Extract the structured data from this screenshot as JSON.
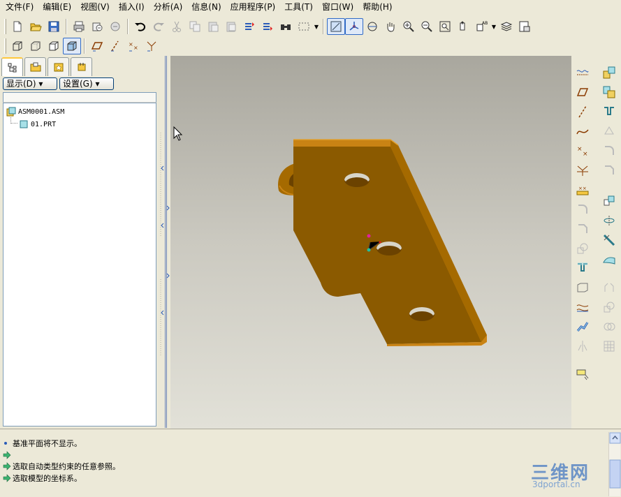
{
  "menu": [
    "文件(F)",
    "编辑(E)",
    "视图(V)",
    "插入(I)",
    "分析(A)",
    "信息(N)",
    "应用程序(P)",
    "工具(T)",
    "窗口(W)",
    "帮助(H)"
  ],
  "navigator": {
    "display_button": "显示(D) ▾",
    "settings_button": "设置(G) ▾",
    "tree": [
      {
        "label": "ASM0001.ASM"
      },
      {
        "label": "01.PRT"
      }
    ]
  },
  "messages": [
    {
      "text": "基准平面将不显示。",
      "icon": "bullet-icon"
    },
    {
      "text": "",
      "icon": "arrow-icon"
    },
    {
      "text": "选取自动类型约束的任意参照。",
      "icon": "arrow-icon"
    },
    {
      "text": "选取模型的坐标系。",
      "icon": "arrow-icon"
    }
  ],
  "watermark": {
    "main": "三维网",
    "sub": "3dportal.cn"
  },
  "colors": {
    "part_face": "#8b5a00",
    "part_top": "#c98314",
    "part_edge": "#e0a030",
    "accent": "#316ac5"
  }
}
